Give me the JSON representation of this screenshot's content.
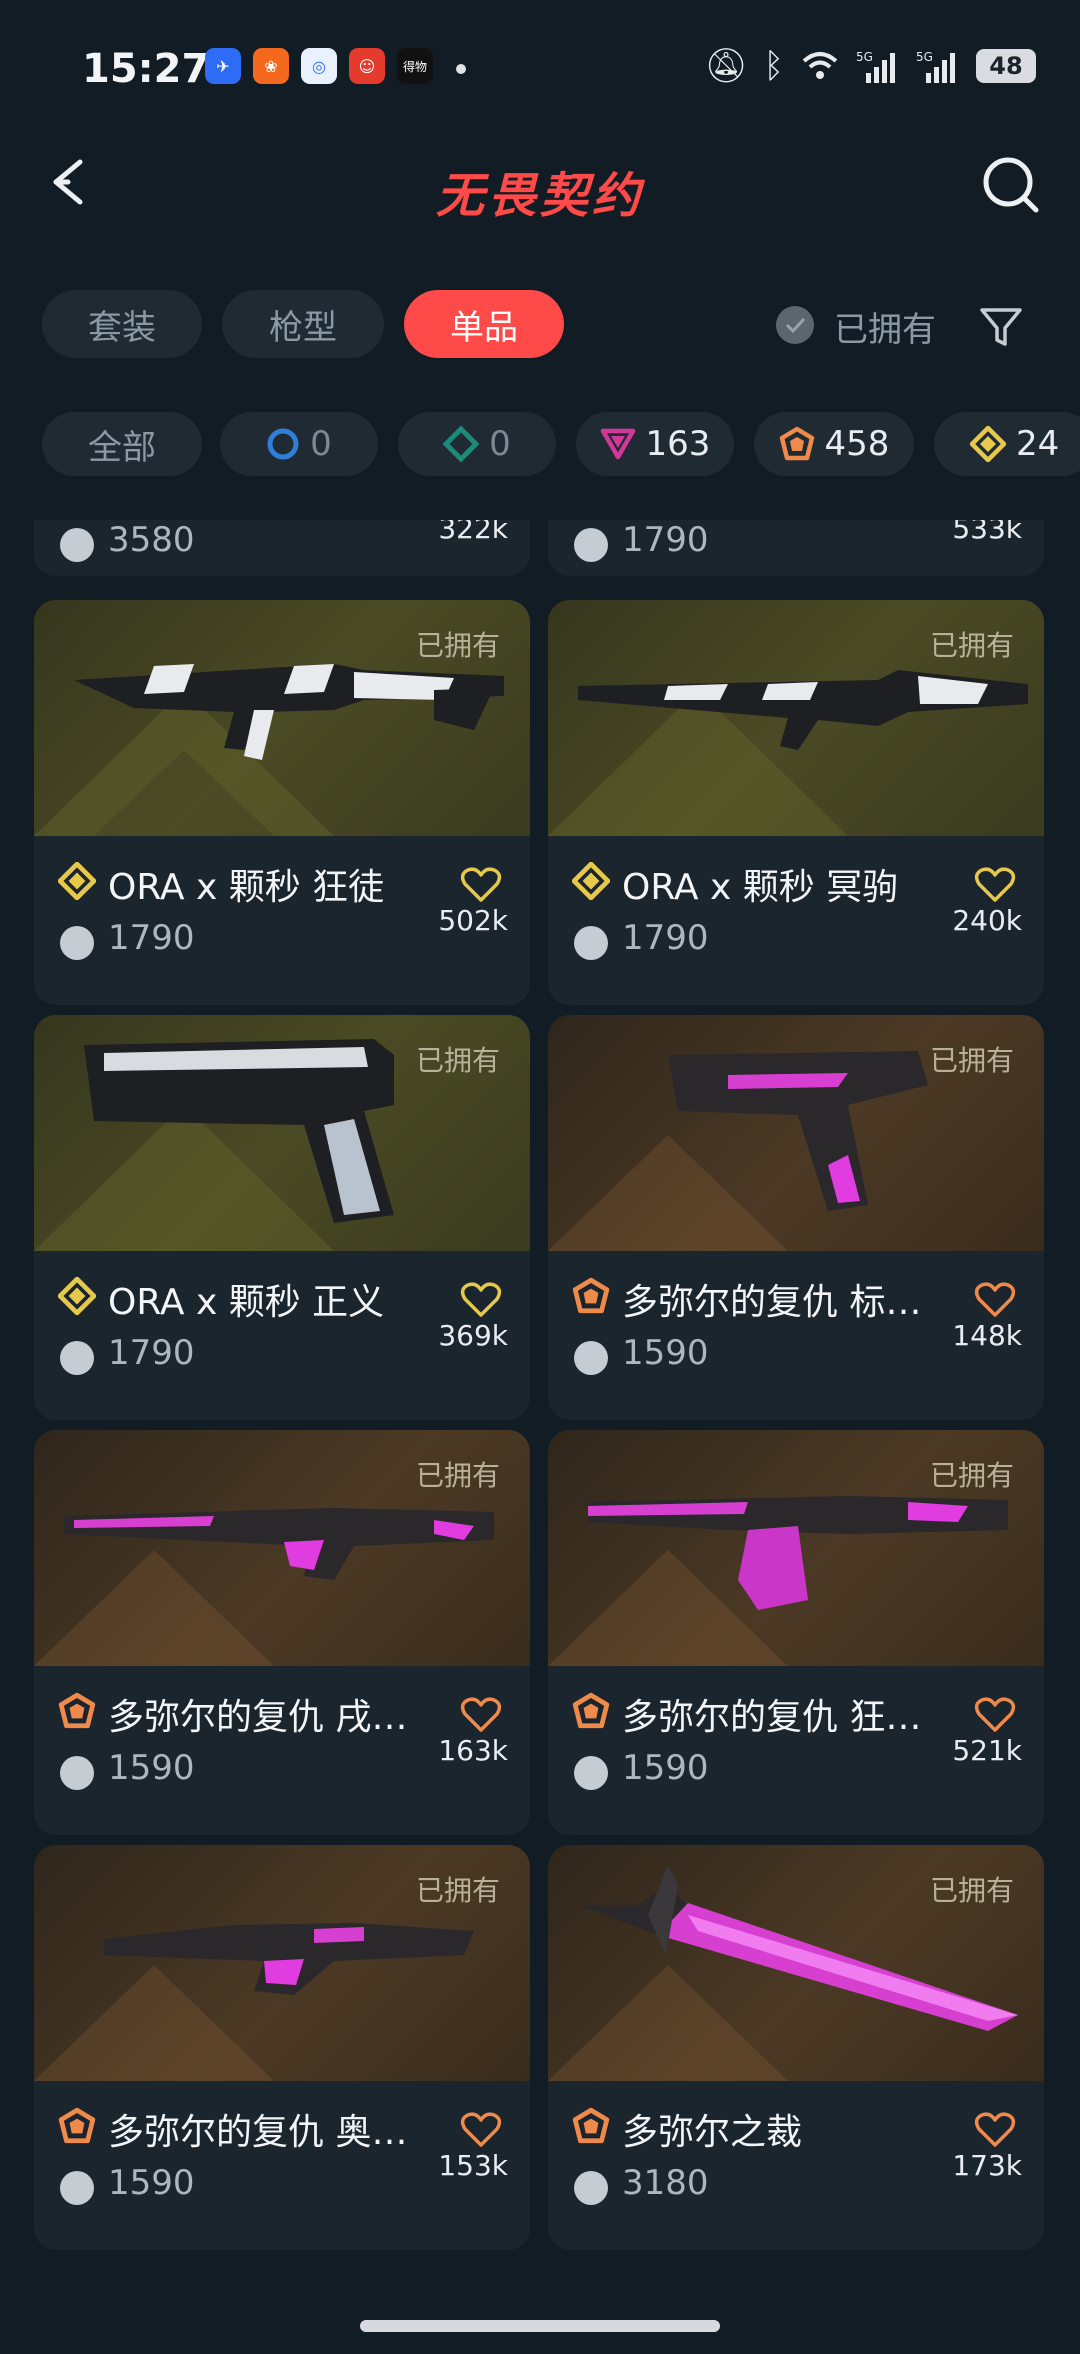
{
  "status_bar": {
    "time": "15:27",
    "notif_apps": [
      {
        "icon": "feishu-icon",
        "color": "#2f6cf6"
      },
      {
        "icon": "app-orange-icon",
        "color": "#f5691f"
      },
      {
        "icon": "app-blue-circle-icon",
        "color": "#e9f1ff"
      },
      {
        "icon": "app-cartoon-icon",
        "color": "#e53a2e"
      },
      {
        "icon": "app-text-icon",
        "label": "得物",
        "color": "#111111"
      }
    ],
    "network": "5G",
    "battery": "48"
  },
  "header": {
    "title": "无畏契约",
    "back_icon": "back-arrow-icon",
    "search_icon": "search-icon"
  },
  "tabs": [
    {
      "label": "套装",
      "active": false
    },
    {
      "label": "枪型",
      "active": false
    },
    {
      "label": "单品",
      "active": true
    }
  ],
  "owned_filter": {
    "label": "已拥有",
    "checked": false
  },
  "rarity_filters": [
    {
      "label": "全部",
      "icon": ""
    },
    {
      "label": "0",
      "icon": "select-tier-icon",
      "color": "#2f7fd8"
    },
    {
      "label": "0",
      "icon": "deluxe-tier-icon",
      "color": "#1d8a7a"
    },
    {
      "label": "163",
      "icon": "premium-tier-icon",
      "color": "#d2389a"
    },
    {
      "label": "458",
      "icon": "exclusive-tier-icon",
      "color": "#f08a4b"
    },
    {
      "label": "24",
      "icon": "ultra-tier-icon",
      "color": "#e6c84a"
    }
  ],
  "partial_row": [
    {
      "price": "3580",
      "likes": "322k"
    },
    {
      "price": "1790",
      "likes": "533k"
    }
  ],
  "items": [
    {
      "name": "ORA x 颗秒 狂徒",
      "price": "1790",
      "likes": "502k",
      "owned": "已拥有",
      "tier": "ultra-tier-icon",
      "tier_color": "#e6c84a",
      "bg": "gold",
      "weapon": "rifle-black-white"
    },
    {
      "name": "ORA x 颗秒 冥驹",
      "price": "1790",
      "likes": "240k",
      "owned": "已拥有",
      "tier": "ultra-tier-icon",
      "tier_color": "#e6c84a",
      "bg": "gold",
      "weapon": "sniper-black-white"
    },
    {
      "name": "ORA x 颗秒 正义",
      "price": "1790",
      "likes": "369k",
      "owned": "已拥有",
      "tier": "ultra-tier-icon",
      "tier_color": "#e6c84a",
      "bg": "gold",
      "weapon": "pistol-black-white"
    },
    {
      "name": "多弥尔的复仇 标…",
      "price": "1590",
      "likes": "148k",
      "owned": "已拥有",
      "tier": "exclusive-tier-icon",
      "tier_color": "#f08a4b",
      "bg": "brown",
      "weapon": "pistol-dark-pink"
    },
    {
      "name": "多弥尔的复仇 戌…",
      "price": "1590",
      "likes": "163k",
      "owned": "已拥有",
      "tier": "exclusive-tier-icon",
      "tier_color": "#f08a4b",
      "bg": "brown",
      "weapon": "rifle-dark-pink"
    },
    {
      "name": "多弥尔的复仇 狂…",
      "price": "1590",
      "likes": "521k",
      "owned": "已拥有",
      "tier": "exclusive-tier-icon",
      "tier_color": "#f08a4b",
      "bg": "brown",
      "weapon": "rifle-dark-pink-crystal"
    },
    {
      "name": "多弥尔的复仇 奥…",
      "price": "1590",
      "likes": "153k",
      "owned": "已拥有",
      "tier": "exclusive-tier-icon",
      "tier_color": "#f08a4b",
      "bg": "brown",
      "weapon": "smg-dark-pink"
    },
    {
      "name": "多弥尔之裁",
      "price": "3180",
      "likes": "173k",
      "owned": "已拥有",
      "tier": "exclusive-tier-icon",
      "tier_color": "#f08a4b",
      "bg": "brown",
      "weapon": "knife-pink"
    }
  ]
}
